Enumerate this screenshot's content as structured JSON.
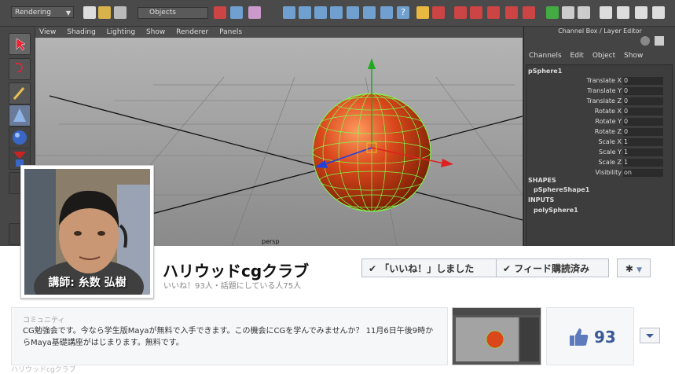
{
  "maya": {
    "mode": "Rendering",
    "selection_mask": "Objects",
    "viewport_menu": [
      "View",
      "Shading",
      "Lighting",
      "Show",
      "Renderer",
      "Panels"
    ],
    "camera_label": "persp",
    "channel_box": {
      "title": "Channel Box / Layer Editor",
      "menu": [
        "Channels",
        "Edit",
        "Object",
        "Show"
      ],
      "object": "pSphere1",
      "attributes": [
        {
          "name": "Translate X",
          "value": "0"
        },
        {
          "name": "Translate Y",
          "value": "0"
        },
        {
          "name": "Translate Z",
          "value": "0"
        },
        {
          "name": "Rotate X",
          "value": "0"
        },
        {
          "name": "Rotate Y",
          "value": "0"
        },
        {
          "name": "Rotate Z",
          "value": "0"
        },
        {
          "name": "Scale X",
          "value": "1"
        },
        {
          "name": "Scale Y",
          "value": "1"
        },
        {
          "name": "Scale Z",
          "value": "1"
        },
        {
          "name": "Visibility",
          "value": "on"
        }
      ],
      "shapes_label": "SHAPES",
      "shape_node": "pSphereShape1",
      "inputs_label": "INPUTS",
      "input_node": "polySphere1"
    },
    "colors": {
      "sphere": "#d9471b",
      "wireframe": "#7dff4f",
      "axis_y": "#1faa1f",
      "axis_x": "#e02020",
      "axis_z": "#2040e0"
    }
  },
  "facebook": {
    "profile_caption": "講師: 糸数 弘樹",
    "page_name": "ハリウッドcgクラブ",
    "stats": "いいね！93人・話題にしている人75人",
    "like_button": "「いいね！」しました",
    "follow_button": "フィード購読済み",
    "about_label": "コミュニティ",
    "about_text": "CG勉強会です。今なら学生版Mayaが無料で入手できます。この機会にCGを学んでみませんか？ 11月6日午後9時からMaya基礎講座がはじまります。無料です。",
    "likes_count": "93",
    "bottom_cut": "ハリウッドcgクラブ"
  }
}
